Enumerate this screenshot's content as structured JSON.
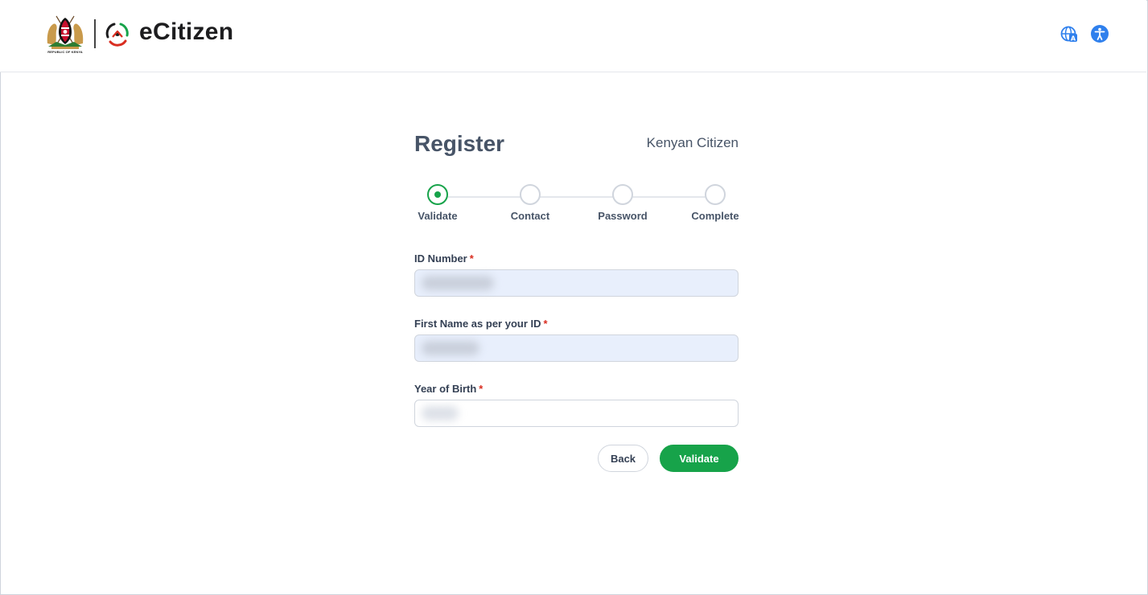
{
  "header": {
    "coat_caption": "REPUBLIC OF KENYA",
    "brand": "eCitizen",
    "icons": {
      "language": "globe-translate-icon",
      "accessibility": "accessibility-icon"
    },
    "colors": {
      "icon_blue": "#2f80ed"
    }
  },
  "form": {
    "title": "Register",
    "citizen_type": "Kenyan Citizen",
    "steps": [
      {
        "label": "Validate",
        "active": true
      },
      {
        "label": "Contact",
        "active": false
      },
      {
        "label": "Password",
        "active": false
      },
      {
        "label": "Complete",
        "active": false
      }
    ],
    "fields": {
      "id_number": {
        "label": "ID Number",
        "required": "*"
      },
      "first_name": {
        "label": "First Name as per your ID",
        "required": "*"
      },
      "year_of_birth": {
        "label": "Year of Birth",
        "required": "*"
      }
    },
    "buttons": {
      "back": "Back",
      "validate": "Validate"
    },
    "colors": {
      "accent": "#17a34a",
      "required": "#d92d20",
      "filled_input": "#e8effc"
    }
  }
}
